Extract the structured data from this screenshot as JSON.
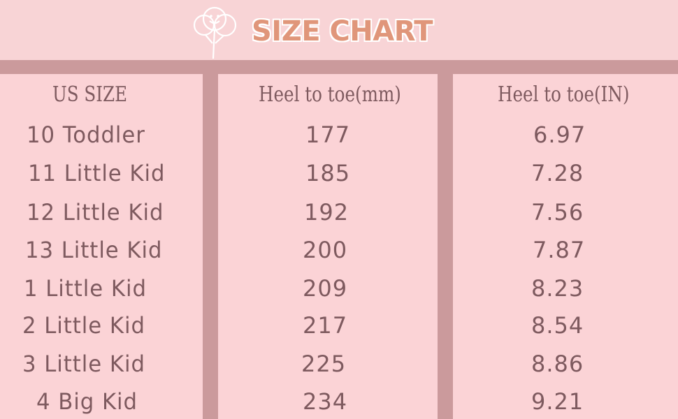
{
  "title": "SIZE CHART",
  "logo_icon": "balloons-icon",
  "colors": {
    "background": "#f6d0d2",
    "divider": "#cb9a9c",
    "title": "#e0967a",
    "text": "#7e5a5f"
  },
  "table": {
    "headers": [
      "US SIZE",
      "Heel to toe(mm)",
      "Heel to toe(IN)"
    ],
    "rows": [
      {
        "size": "10 Toddler",
        "mm": "177",
        "in": "6.97"
      },
      {
        "size": "11  Little Kid",
        "mm": "185",
        "in": "7.28"
      },
      {
        "size": "12 Little Kid",
        "mm": "192",
        "in": "7.56"
      },
      {
        "size": "13 Little Kid",
        "mm": "200",
        "in": "7.87"
      },
      {
        "size": "1 Little Kid",
        "mm": "209",
        "in": "8.23"
      },
      {
        "size": "2 Little Kid",
        "mm": "217",
        "in": "8.54"
      },
      {
        "size": "3 Little Kid",
        "mm": "225",
        "in": "8.86"
      },
      {
        "size": "4 Big Kid",
        "mm": "234",
        "in": "9.21"
      }
    ]
  }
}
